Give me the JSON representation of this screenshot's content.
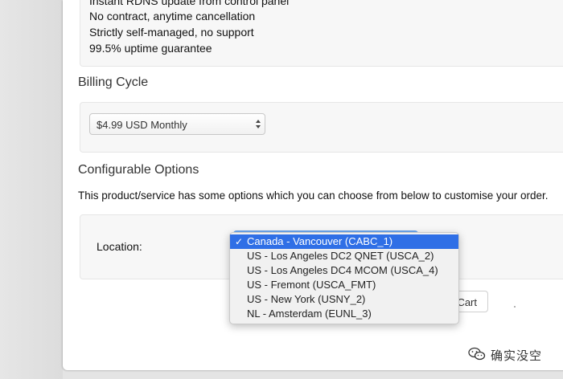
{
  "features": [
    "Instant RDNS update from control panel",
    "No contract, anytime cancellation",
    "Strictly self-managed, no support",
    "99.5% uptime guarantee"
  ],
  "billing": {
    "title": "Billing Cycle",
    "selected": "$4.99 USD Monthly"
  },
  "config": {
    "title": "Configurable Options",
    "description": "This product/service has some options which you can choose from below to customise your order.",
    "location_label": "Location:",
    "location_options": [
      "Canada - Vancouver (CABC_1)",
      "US - Los Angeles DC2 QNET (USCA_2)",
      "US - Los Angeles DC4 MCOM (USCA_4)",
      "US - Fremont (USCA_FMT)",
      "US - New York (USNY_2)",
      "NL - Amsterdam (EUNL_3)"
    ],
    "selected_index": 0,
    "check_glyph": "✓"
  },
  "cart_button": "Cart",
  "watermark": "确实没空",
  "colors": {
    "selection": "#2f6fe6",
    "panel_bg": "#ffffff",
    "box_bg": "#f7f7f7"
  }
}
